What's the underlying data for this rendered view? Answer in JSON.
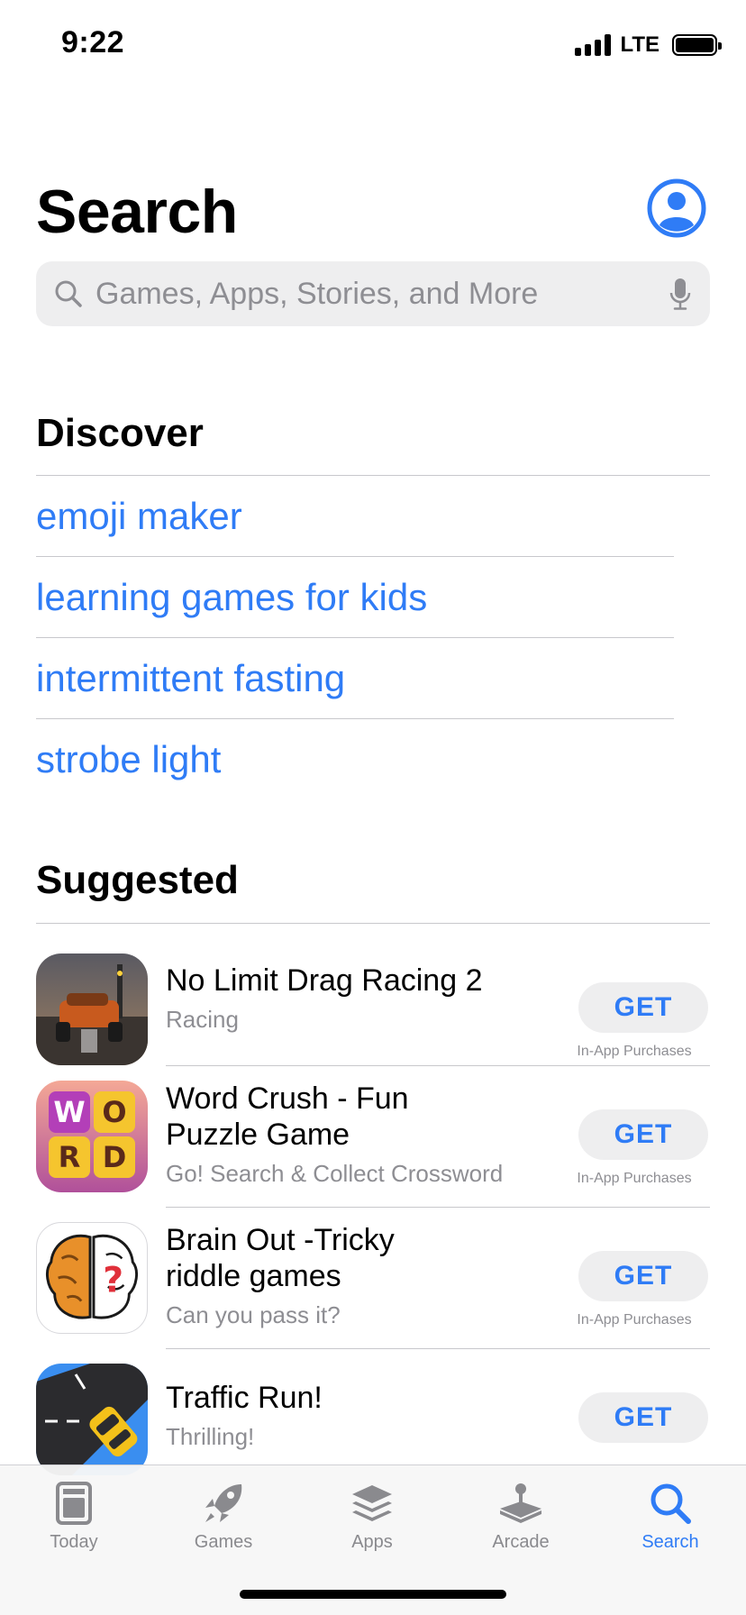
{
  "status_bar": {
    "time": "9:22",
    "network": "LTE"
  },
  "header": {
    "title": "Search"
  },
  "search": {
    "placeholder": "Games, Apps, Stories, and More"
  },
  "discover": {
    "title": "Discover",
    "items": [
      {
        "label": "emoji maker"
      },
      {
        "label": "learning games for kids"
      },
      {
        "label": "intermittent fasting"
      },
      {
        "label": "strobe light"
      }
    ]
  },
  "suggested": {
    "title": "Suggested",
    "apps": [
      {
        "name": "No Limit Drag Racing 2",
        "subtitle": "Racing",
        "button": "GET",
        "note": "In-App Purchases",
        "icon": "drag-racing-icon"
      },
      {
        "name": "Word Crush - Fun Puzzle Game",
        "subtitle": "Go! Search & Collect Crossword",
        "button": "GET",
        "note": "In-App Purchases",
        "icon": "word-crush-icon",
        "icon_letters": [
          "W",
          "O",
          "R",
          "D"
        ]
      },
      {
        "name": "Brain Out -Tricky riddle games",
        "subtitle": "Can you pass it?",
        "button": "GET",
        "note": "In-App Purchases",
        "icon": "brain-out-icon",
        "icon_mark": "?"
      },
      {
        "name": "Traffic Run!",
        "subtitle": "Thrilling!",
        "button": "GET",
        "icon": "traffic-run-icon"
      }
    ]
  },
  "tab_bar": {
    "tabs": [
      {
        "label": "Today",
        "icon": "today-icon"
      },
      {
        "label": "Games",
        "icon": "rocket-icon"
      },
      {
        "label": "Apps",
        "icon": "apps-stack-icon"
      },
      {
        "label": "Arcade",
        "icon": "joystick-icon"
      },
      {
        "label": "Search",
        "icon": "search-icon",
        "active": true
      }
    ]
  },
  "colors": {
    "accent": "#2f7cf6",
    "secondary_text": "#8e8e93",
    "field_bg": "#eeeeef"
  }
}
